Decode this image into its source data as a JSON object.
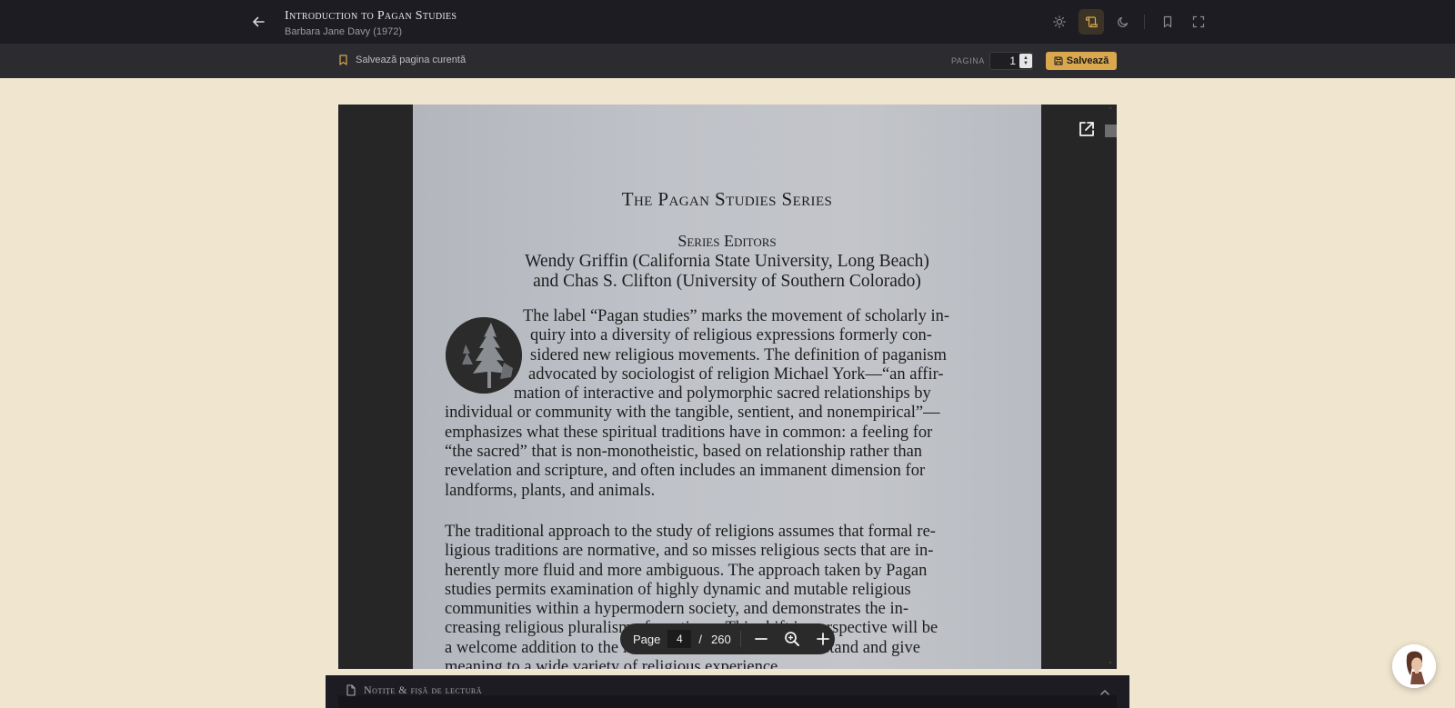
{
  "header": {
    "book_title": "Introduction to Pagan Studies",
    "book_author": "Barbara Jane Davy (1972)",
    "tools": [
      "sun-icon",
      "scroll-icon",
      "moon-icon",
      "bookmark-icon",
      "fullscreen-icon"
    ]
  },
  "subbar": {
    "save_current_label": "Salvează pagina curentă",
    "pagina_label": "PAGINA",
    "page_value": "1",
    "save_button_label": "Salvează"
  },
  "document": {
    "series_title": "The Pagan Studies Series",
    "series_editors": "Series Editors",
    "editors_line1": "Wendy Griffin (California State University, Long Beach)",
    "editors_line2": "and Chas S. Clifton (University of Southern Colorado)",
    "para1": [
      "The label “Pagan studies” marks the movement of scholarly in-",
      "quiry into a diversity of religious expressions formerly con-",
      "sidered new religious movements. The definition of paganism",
      "advocated by sociologist of religion Michael York—“an affir-",
      "mation of interactive and polymorphic sacred relationships by",
      "individual or community with the tangible, sentient, and nonempirical”—",
      "emphasizes what these spiritual traditions have in common: a feeling for",
      "“the sacred” that is non-monotheistic, based on relationship rather than",
      "revelation and scripture, and often includes an immanent dimension for",
      "landforms, plants, and animals."
    ],
    "para2": [
      "The traditional approach to the study of religions assumes that formal re-",
      "ligious traditions are normative, and so misses religious sects that are in-",
      "herently more fluid and more ambiguous. The approach taken by Pagan",
      "studies permits examination of highly dynamic and mutable religious",
      "communities within a hypermodern society, and demonstrates the in-",
      "creasing religious pluralism of our times. This shift in perspective will be",
      "a welcome addition to the intellectual endeavor to understand and give",
      "meaning to a wide variety of religious experience."
    ]
  },
  "viewer_controls": {
    "page_label": "Page",
    "current_page": "4",
    "slash": "/",
    "total_pages": "260"
  },
  "notes": {
    "title": "Notițe & fișă de lectură"
  },
  "colors": {
    "accent": "#d9a84e",
    "topbar": "#1c1c22",
    "background": "#f0e6d0"
  }
}
